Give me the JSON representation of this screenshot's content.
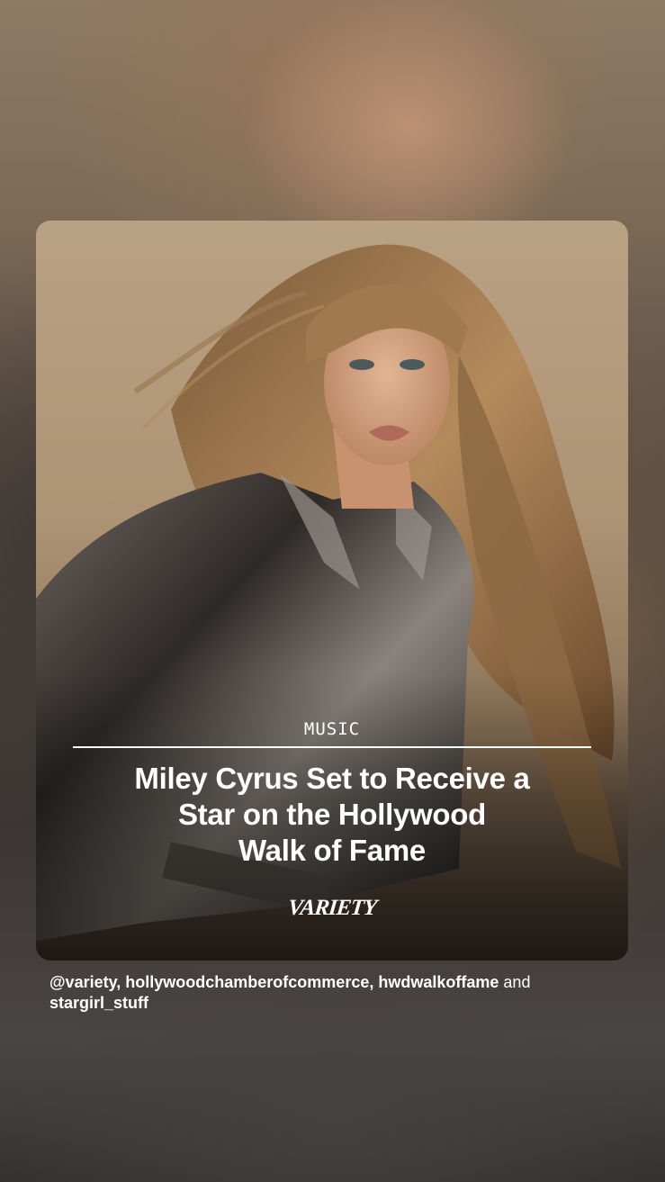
{
  "story_card": {
    "section": "MUSIC",
    "headline_lines": [
      "Miley Cyrus Set to Receive a",
      "Star on the Hollywood",
      "Walk of Fame"
    ],
    "brand": "VARIETY"
  },
  "mentions": {
    "handles": [
      "@variety,",
      "hollywoodchamberofcommerce,",
      "hwdwalkoffame"
    ],
    "conjunction": "and",
    "last_handle": "stargirl_stuff"
  }
}
